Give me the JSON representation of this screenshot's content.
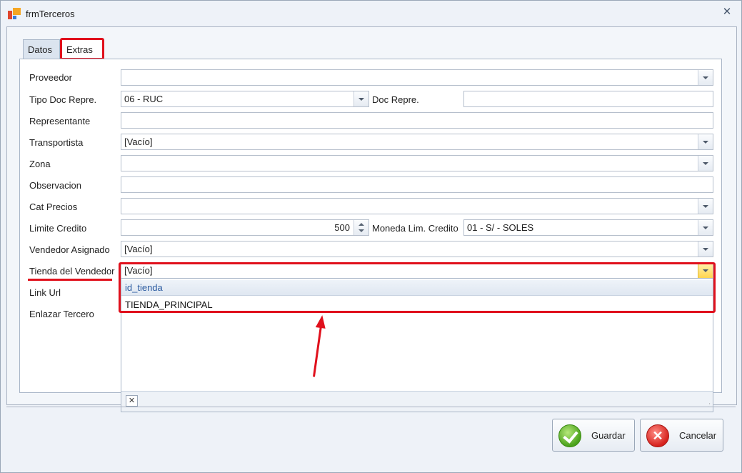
{
  "window": {
    "title": "frmTerceros",
    "close_glyph": "✕"
  },
  "tabs": [
    {
      "label": "Datos"
    },
    {
      "label": "Extras"
    }
  ],
  "form": {
    "proveedor": {
      "label": "Proveedor",
      "value": ""
    },
    "tipo_doc_repre": {
      "label": "Tipo Doc Repre.",
      "value": "06 - RUC"
    },
    "doc_repre": {
      "label": "Doc Repre.",
      "value": ""
    },
    "representante": {
      "label": "Representante",
      "value": ""
    },
    "transportista": {
      "label": "Transportista",
      "value": "[Vacío]"
    },
    "zona": {
      "label": "Zona",
      "value": ""
    },
    "observacion": {
      "label": "Observacion",
      "value": ""
    },
    "cat_precios": {
      "label": "Cat Precios",
      "value": ""
    },
    "limite_credito": {
      "label": "Limite Credito",
      "value": "500"
    },
    "moneda_lim_credito": {
      "label": "Moneda Lim. Credito",
      "value": "01 - S/  - SOLES"
    },
    "vendedor_asignado": {
      "label": "Vendedor Asignado",
      "value": "[Vacío]"
    },
    "tienda_del_vendedor": {
      "label": "Tienda del Vendedor",
      "value": "[Vacío]"
    },
    "link_url": {
      "label": "Link Url"
    },
    "enlazar_tercero": {
      "label": "Enlazar Tercero"
    }
  },
  "dropdown": {
    "column_header": "id_tienda",
    "items": [
      "TIENDA_PRINCIPAL"
    ],
    "close_glyph": "✕",
    "grip_glyph": ".:"
  },
  "buttons": {
    "guardar": "Guardar",
    "cancelar": "Cancelar",
    "cancel_glyph": "✕"
  },
  "colors": {
    "annotation_red": "#e0101c",
    "accent_blue": "#2a5aa0"
  }
}
